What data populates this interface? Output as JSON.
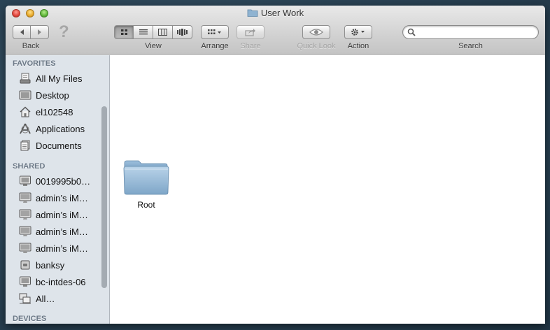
{
  "window": {
    "title": "User Work"
  },
  "toolbar": {
    "back_label": "Back",
    "help_symbol": "?",
    "view_label": "View",
    "arrange_label": "Arrange",
    "share_label": "Share",
    "quicklook_label": "Quick Look",
    "action_label": "Action",
    "search_label": "Search",
    "search_value": "",
    "active_view": "icon"
  },
  "sidebar": {
    "favorites_header": "FAVORITES",
    "favorites": [
      {
        "label": "All My Files",
        "icon": "all-files-icon"
      },
      {
        "label": "Desktop",
        "icon": "desktop-icon"
      },
      {
        "label": "el102548",
        "icon": "home-icon"
      },
      {
        "label": "Applications",
        "icon": "applications-icon"
      },
      {
        "label": "Documents",
        "icon": "documents-icon"
      }
    ],
    "shared_header": "SHARED",
    "shared": [
      {
        "label": "0019995b0…",
        "icon": "computer-icon"
      },
      {
        "label": "admin’s iM…",
        "icon": "imac-icon"
      },
      {
        "label": "admin’s iM…",
        "icon": "imac-icon"
      },
      {
        "label": "admin’s iM…",
        "icon": "imac-icon"
      },
      {
        "label": "admin’s iM…",
        "icon": "imac-icon"
      },
      {
        "label": "banksy",
        "icon": "server-icon"
      },
      {
        "label": "bc-intdes-06",
        "icon": "computer-icon"
      },
      {
        "label": "All…",
        "icon": "network-icon"
      }
    ],
    "devices_header": "DEVICES"
  },
  "content": {
    "items": [
      {
        "label": "Root",
        "icon": "folder-icon"
      }
    ]
  },
  "colors": {
    "folder": "#8fb3d1",
    "sidebar_bg": "#dee4ea",
    "section_header": "#6c7987"
  }
}
